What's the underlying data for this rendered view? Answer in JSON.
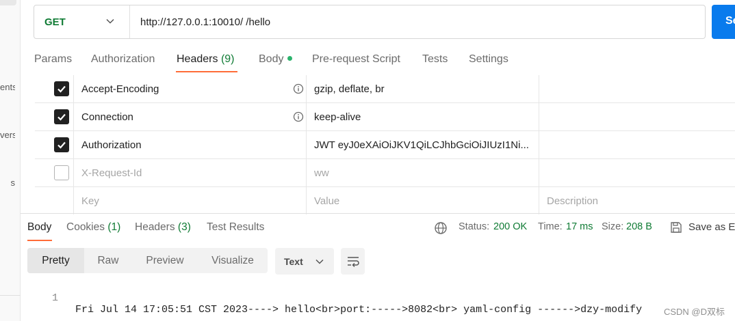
{
  "sidebar": {
    "fragments": [
      "ents",
      "vers",
      "s"
    ]
  },
  "request": {
    "method": "GET",
    "url": "http://127.0.0.1:10010/ /hello",
    "send_label": "Se"
  },
  "request_tabs": {
    "params": "Params",
    "authorization": "Authorization",
    "headers": "Headers",
    "headers_count": "(9)",
    "body": "Body",
    "pre_request": "Pre-request Script",
    "tests": "Tests",
    "settings": "Settings"
  },
  "headers_table": {
    "rows": [
      {
        "key": "Accept-Encoding",
        "value": "gzip, deflate, br",
        "checked": true
      },
      {
        "key": "Connection",
        "value": "keep-alive",
        "checked": true
      },
      {
        "key": "Authorization",
        "value": "JWT eyJ0eXAiOiJKV1QiLCJhbGciOiJIUzI1Ni...",
        "checked": true
      },
      {
        "key": "X-Request-Id",
        "value": "ww",
        "checked": false
      }
    ],
    "placeholder": {
      "key": "Key",
      "value": "Value",
      "description": "Description"
    }
  },
  "response_tabs": {
    "body": "Body",
    "cookies": "Cookies",
    "cookies_count": "(1)",
    "headers": "Headers",
    "headers_count": "(3)",
    "test_results": "Test Results"
  },
  "response_status": {
    "status_label": "Status:",
    "status_value": "200 OK",
    "time_label": "Time:",
    "time_value": "17 ms",
    "size_label": "Size:",
    "size_value": "208 B",
    "save_label": "Save as E"
  },
  "view_modes": [
    "Pretty",
    "Raw",
    "Preview",
    "Visualize"
  ],
  "format": "Text",
  "response_body": {
    "line_number": "1",
    "text": "Fri Jul 14 17:05:51 CST 2023----> hello<br>port:----->8082<br> yaml-config ------>dzy-modify"
  },
  "watermark": "CSDN @D双标",
  "colors": {
    "accent": "#ff6c37",
    "success": "#0f7b34",
    "send": "#097bed"
  }
}
